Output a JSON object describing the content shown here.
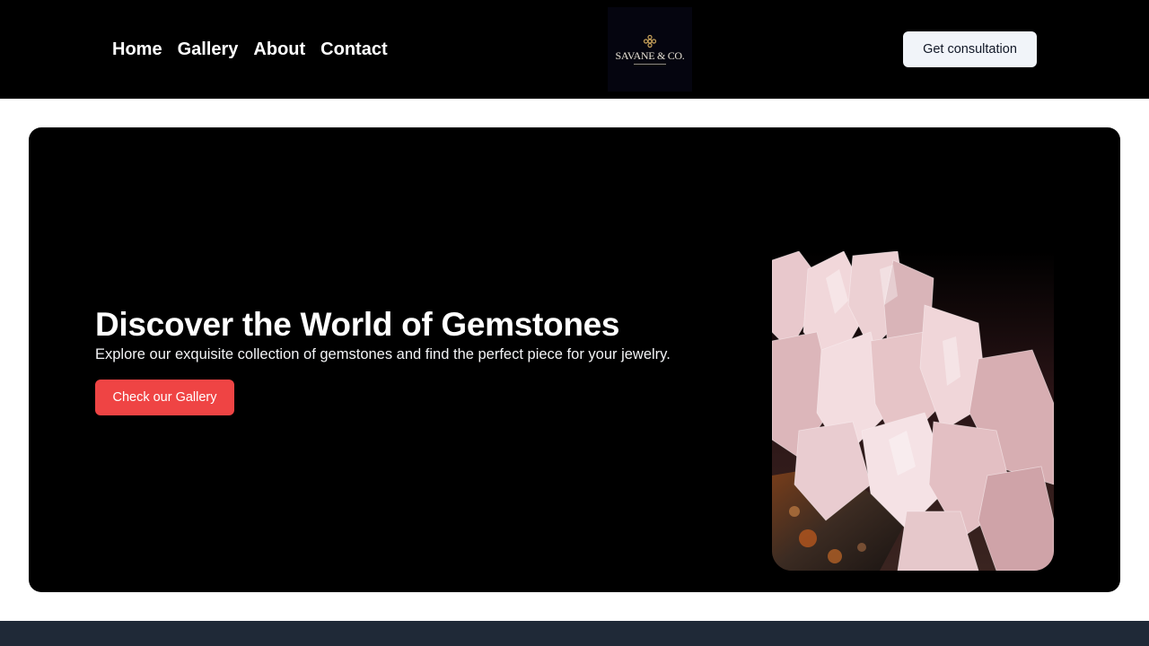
{
  "nav": {
    "items": [
      {
        "label": "Home"
      },
      {
        "label": "Gallery"
      },
      {
        "label": "About"
      },
      {
        "label": "Contact"
      }
    ]
  },
  "logo": {
    "text": "SAVANE & CO.",
    "icon": "flower-ornament-icon"
  },
  "header": {
    "cta_label": "Get consultation"
  },
  "hero": {
    "title": "Discover the World of Gemstones",
    "subtitle": "Explore our exquisite collection of gemstones and find the perfect piece for your jewelry.",
    "button_label": "Check our Gallery"
  },
  "colors": {
    "header_bg": "#000000",
    "hero_bg": "#000000",
    "accent": "#ef4444",
    "cta_bg": "#f1f4f9",
    "footer_bg": "#1f2937"
  }
}
